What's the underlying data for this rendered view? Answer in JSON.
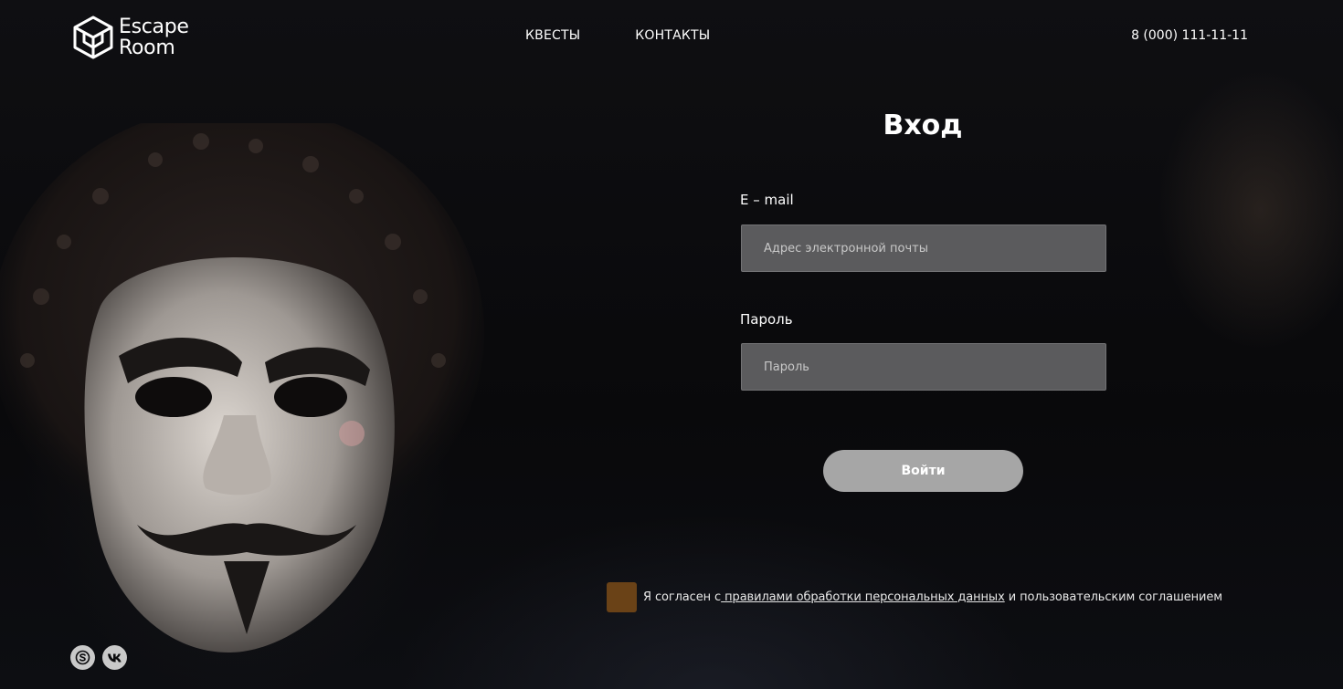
{
  "header": {
    "logo_line1": "Escape",
    "logo_line2": "Room",
    "nav": [
      {
        "label": "КВЕСТЫ"
      },
      {
        "label": "КОНТАКТЫ"
      }
    ],
    "phone": "8 (000) 111-11-11"
  },
  "login": {
    "title": "Вход",
    "email_label": "E – mail",
    "email_placeholder": "Адрес электронной почты",
    "email_value": "",
    "password_label": "Пароль",
    "password_placeholder": "Пароль",
    "password_value": "",
    "submit_label": "Войти"
  },
  "agreement": {
    "prefix": "Я согласен с",
    "link": " правилами обработки персональных данных",
    "suffix": " и пользовательским соглашением",
    "checked": false
  },
  "socials": [
    {
      "icon": "skype-icon"
    },
    {
      "icon": "vk-icon"
    }
  ],
  "colors": {
    "background": "#0b0b0d",
    "input_bg": "#5b5b5d",
    "button_bg": "#a6a6a6",
    "checkbox_bg": "#6a4217"
  }
}
